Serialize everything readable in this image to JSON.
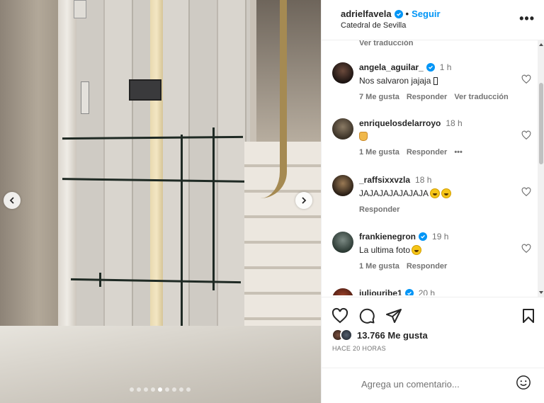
{
  "header": {
    "username": "adrielfavela",
    "follow_label": "Seguir",
    "location": "Catedral de Sevilla",
    "separator": "•",
    "more_label": "•••"
  },
  "top_translate": "Ver traducción",
  "comments": [
    {
      "username": "angela_aguilar_",
      "verified": true,
      "time": "1 h",
      "text": "Nos salvaron jajaja",
      "likes_label": "7 Me gusta",
      "reply_label": "Responder",
      "translate_label": "Ver traducción"
    },
    {
      "username": "enriquelosdelarroyo",
      "verified": false,
      "time": "18 h",
      "text": "",
      "likes_label": "1 Me gusta",
      "reply_label": "Responder",
      "more_label": "•••"
    },
    {
      "username": "_raffsixxvzla",
      "verified": false,
      "time": "18 h",
      "text": "JAJAJAJAJAJAJA",
      "reply_label": "Responder"
    },
    {
      "username": "frankienegron",
      "verified": true,
      "time": "19 h",
      "text": "La ultima foto",
      "likes_label": "1 Me gusta",
      "reply_label": "Responder"
    },
    {
      "username": "juliouribe1",
      "verified": true,
      "time": "20 h"
    }
  ],
  "likes": {
    "count_label": "13.766 Me gusta"
  },
  "posted": "HACE 20 HORAS",
  "comment_input": {
    "placeholder": "Agrega un comentario..."
  },
  "carousel": {
    "total": 9,
    "active_index": 4
  },
  "icons": [
    "chevron-left-icon",
    "chevron-right-icon",
    "verified-icon",
    "heart-icon",
    "comment-icon",
    "share-icon",
    "bookmark-icon",
    "smile-icon"
  ],
  "colors": {
    "accent": "#0095f6",
    "muted": "#737373",
    "text": "#262626"
  }
}
